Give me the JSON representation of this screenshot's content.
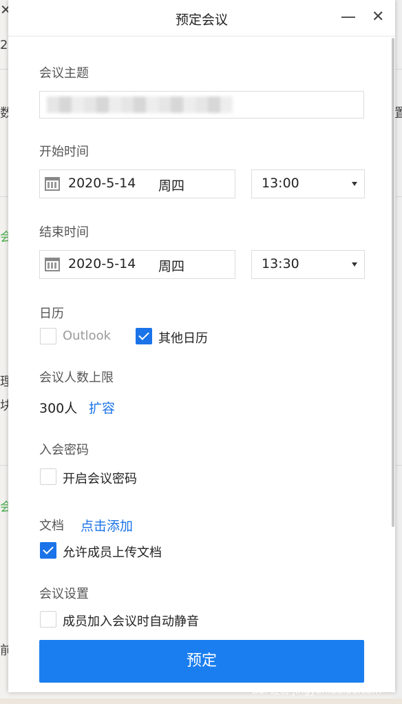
{
  "background": {
    "fragments": [
      "2",
      "数",
      "置",
      "会",
      "理",
      "块",
      "会",
      "前"
    ]
  },
  "dialog": {
    "title": "预定会议",
    "topic": {
      "label": "会议主题",
      "value": ""
    },
    "start": {
      "label": "开始时间",
      "date": "2020-5-14",
      "weekday": "周四",
      "time": "13:00"
    },
    "end": {
      "label": "结束时间",
      "date": "2020-5-14",
      "weekday": "周四",
      "time": "13:30"
    },
    "calendar": {
      "label": "日历",
      "outlook": "Outlook",
      "outlook_checked": false,
      "other": "其他日历",
      "other_checked": true
    },
    "capacity": {
      "label": "会议人数上限",
      "value": "300人",
      "expand": "扩容"
    },
    "password": {
      "label": "入会密码",
      "option": "开启会议密码",
      "checked": false
    },
    "docs": {
      "label": "文档",
      "add": "点击添加",
      "allow": "允许成员上传文档",
      "allow_checked": true
    },
    "settings": {
      "label": "会议设置",
      "mute": "成员加入会议时自动静音",
      "mute_checked": false
    },
    "submit": "预定"
  },
  "colors": {
    "accent": "#1a73e8",
    "button": "#1a7ef0"
  },
  "watermark": "Bai 经验 jingyan.baidu.com"
}
